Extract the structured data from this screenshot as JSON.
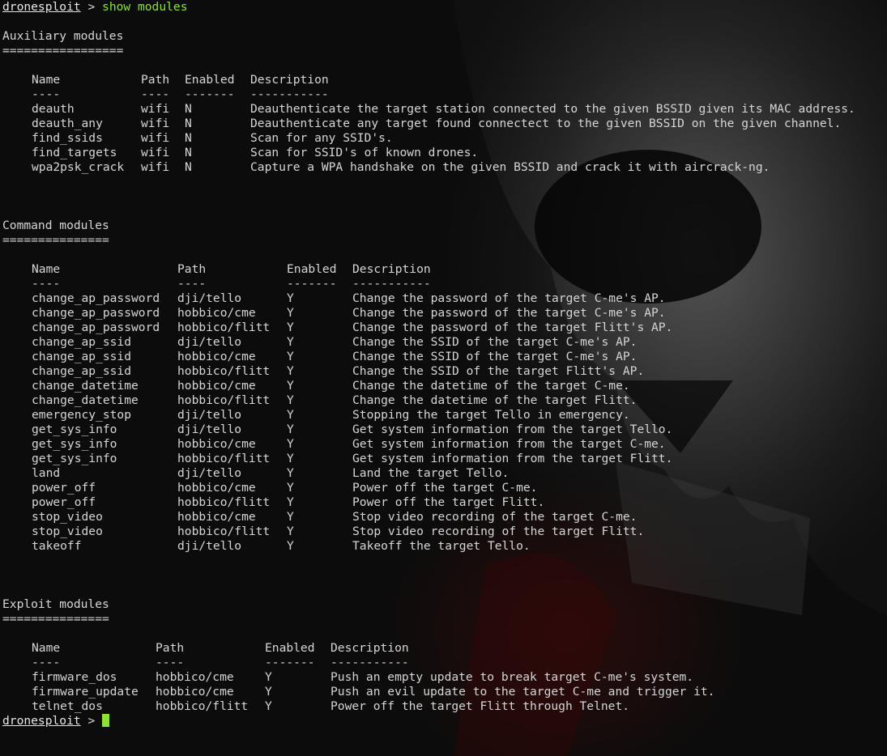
{
  "prompt": {
    "name": "dronesploit",
    "separator": ">",
    "command": "show modules"
  },
  "sections": [
    {
      "title": "Auxiliary modules",
      "underline": "=================",
      "columns": [
        "Name",
        "Path",
        "Enabled",
        "Description"
      ],
      "dashes": [
        "----",
        "----",
        "-------",
        "-----------"
      ],
      "rows": [
        [
          "deauth",
          "wifi",
          "N",
          "Deauthenticate the target station connected to the given BSSID given its MAC address."
        ],
        [
          "deauth_any",
          "wifi",
          "N",
          "Deauthenticate any target found connectect to the given BSSID on the given channel."
        ],
        [
          "find_ssids",
          "wifi",
          "N",
          "Scan for any SSID's."
        ],
        [
          "find_targets",
          "wifi",
          "N",
          "Scan for SSID's of known drones."
        ],
        [
          "wpa2psk_crack",
          "wifi",
          "N",
          "Capture a WPA handshake on the given BSSID and crack it with aircrack-ng."
        ]
      ]
    },
    {
      "title": "Command modules",
      "underline": "===============",
      "columns": [
        "Name",
        "Path",
        "Enabled",
        "Description"
      ],
      "dashes": [
        "----",
        "----",
        "-------",
        "-----------"
      ],
      "rows": [
        [
          "change_ap_password",
          "dji/tello",
          "Y",
          "Change the password of the target C-me's AP."
        ],
        [
          "change_ap_password",
          "hobbico/cme",
          "Y",
          "Change the password of the target C-me's AP."
        ],
        [
          "change_ap_password",
          "hobbico/flitt",
          "Y",
          "Change the password of the target Flitt's AP."
        ],
        [
          "change_ap_ssid",
          "dji/tello",
          "Y",
          "Change the SSID of the target C-me's AP."
        ],
        [
          "change_ap_ssid",
          "hobbico/cme",
          "Y",
          "Change the SSID of the target C-me's AP."
        ],
        [
          "change_ap_ssid",
          "hobbico/flitt",
          "Y",
          "Change the SSID of the target Flitt's AP."
        ],
        [
          "change_datetime",
          "hobbico/cme",
          "Y",
          "Change the datetime of the target C-me."
        ],
        [
          "change_datetime",
          "hobbico/flitt",
          "Y",
          "Change the datetime of the target Flitt."
        ],
        [
          "emergency_stop",
          "dji/tello",
          "Y",
          "Stopping the target Tello in emergency."
        ],
        [
          "get_sys_info",
          "dji/tello",
          "Y",
          "Get system information from the target Tello."
        ],
        [
          "get_sys_info",
          "hobbico/cme",
          "Y",
          "Get system information from the target C-me."
        ],
        [
          "get_sys_info",
          "hobbico/flitt",
          "Y",
          "Get system information from the target Flitt."
        ],
        [
          "land",
          "dji/tello",
          "Y",
          "Land the target Tello."
        ],
        [
          "power_off",
          "hobbico/cme",
          "Y",
          "Power off the target C-me."
        ],
        [
          "power_off",
          "hobbico/flitt",
          "Y",
          "Power off the target Flitt."
        ],
        [
          "stop_video",
          "hobbico/cme",
          "Y",
          "Stop video recording of the target C-me."
        ],
        [
          "stop_video",
          "hobbico/flitt",
          "Y",
          "Stop video recording of the target Flitt."
        ],
        [
          "takeoff",
          "dji/tello",
          "Y",
          "Takeoff the target Tello."
        ]
      ]
    },
    {
      "title": "Exploit modules",
      "underline": "===============",
      "columns": [
        "Name",
        "Path",
        "Enabled",
        "Description"
      ],
      "dashes": [
        "----",
        "----",
        "-------",
        "-----------"
      ],
      "rows": [
        [
          "firmware_dos",
          "hobbico/cme",
          "Y",
          "Push an empty update to break target C-me's system."
        ],
        [
          "firmware_update",
          "hobbico/cme",
          "Y",
          "Push an evil update to the target C-me and trigger it."
        ],
        [
          "telnet_dos",
          "hobbico/flitt",
          "Y",
          "Power off the target Flitt through Telnet."
        ]
      ]
    }
  ],
  "final_prompt": {
    "name": "dronesploit",
    "separator": ">"
  },
  "colors": {
    "prompt_command": "#8ae234",
    "cursor": "#8ae234",
    "text": "#d6d6d6"
  }
}
